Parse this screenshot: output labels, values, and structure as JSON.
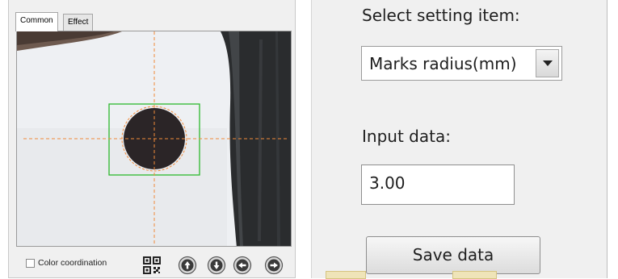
{
  "tabs": [
    {
      "label": "Common",
      "active": true
    },
    {
      "label": "Effect",
      "active": false
    }
  ],
  "camera": {
    "crosshair_color": "#f08a3a",
    "roi_color": "#2db82d",
    "mark_color": "#2b2527"
  },
  "bottom_bar": {
    "color_coordination_label": "Color coordination",
    "color_coordination_checked": false,
    "icons": [
      "qr-code-icon",
      "move-up-icon",
      "move-down-icon",
      "move-left-icon",
      "move-right-icon"
    ]
  },
  "settings": {
    "select_label": "Select setting item:",
    "selected_item": "Marks radius(mm)",
    "input_label": "Input data:",
    "input_value": "3.00",
    "save_label": "Save data"
  }
}
